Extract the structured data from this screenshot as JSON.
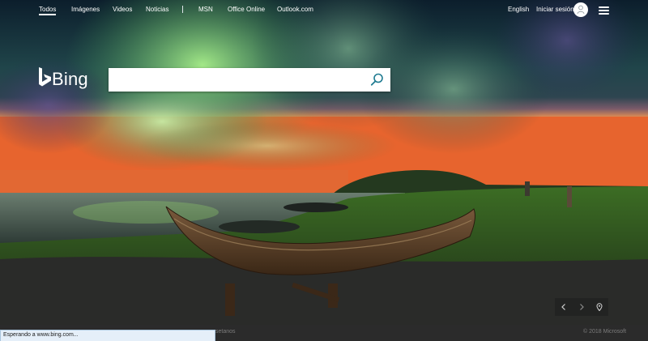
{
  "nav": {
    "left_links": [
      "Todos",
      "Imágenes",
      "Videos",
      "Noticias",
      "MSN",
      "Office Online",
      "Outlook.com"
    ],
    "language": "English",
    "signin": "Iniciar sesión"
  },
  "logo": {
    "text": "Bing"
  },
  "search": {
    "value": "",
    "placeholder": ""
  },
  "footer": {
    "partial_label": "setanos",
    "copyright": "© 2018 Microsoft"
  },
  "status": {
    "text": "Esperando a www.bing.com..."
  },
  "icons": {
    "search": "magnifier-icon",
    "user": "user-icon",
    "menu": "hamburger-icon",
    "prev": "chevron-left-icon",
    "next": "chevron-right-icon",
    "location": "location-pin-icon"
  },
  "colors": {
    "accent": "#1f7b91",
    "footer_bg": "#2b2b2b",
    "status_bg": "#e5eff9"
  }
}
